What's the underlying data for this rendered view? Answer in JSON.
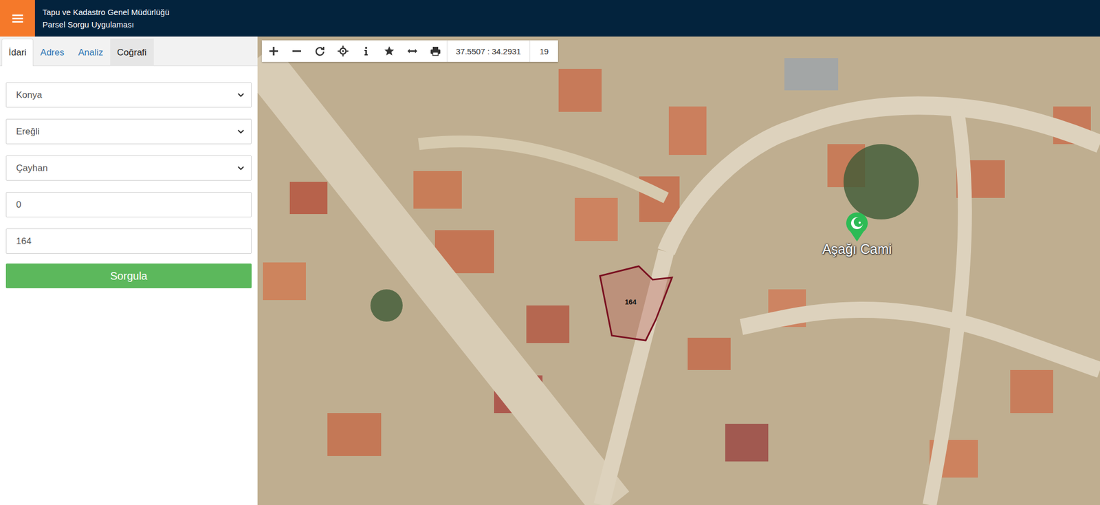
{
  "header": {
    "title_lines": [
      "Tapu ve Kadastro Genel Müdürlüğü",
      "Parsel Sorgu Uygulaması"
    ]
  },
  "tabs": [
    {
      "label": "İdari",
      "selected": true,
      "highlighted": false
    },
    {
      "label": "Adres",
      "selected": false,
      "highlighted": false
    },
    {
      "label": "Analiz",
      "selected": false,
      "highlighted": false
    },
    {
      "label": "Coğrafi",
      "selected": false,
      "highlighted": true
    }
  ],
  "form": {
    "fields": [
      {
        "kind": "select",
        "value": "Konya"
      },
      {
        "kind": "select",
        "value": "Ereğli"
      },
      {
        "kind": "select",
        "value": "Çayhan"
      },
      {
        "kind": "input",
        "value": "0"
      },
      {
        "kind": "input",
        "value": "164"
      }
    ],
    "button": "Sorgula"
  },
  "map": {
    "toolbar": {
      "coordinates": "37.5507 : 34.2931",
      "zoom": "19"
    },
    "parcel": {
      "label": "164"
    },
    "places": [
      {
        "name": "Aşağı Cami"
      }
    ]
  }
}
